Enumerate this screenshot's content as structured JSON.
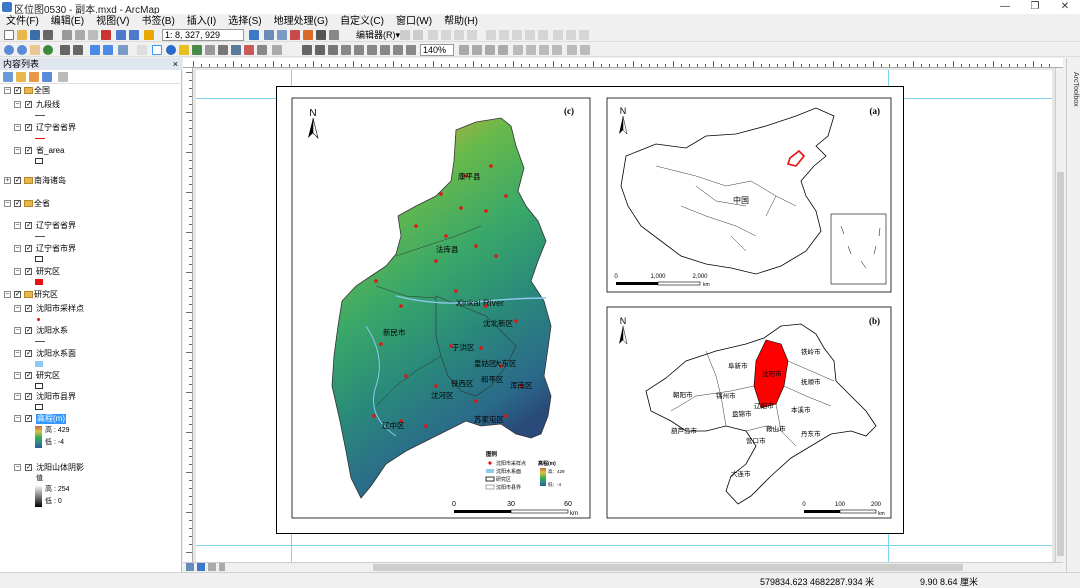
{
  "window": {
    "title": "区位图0530 - 副本.mxd - ArcMap"
  },
  "menu": [
    "文件(F)",
    "编辑(E)",
    "视图(V)",
    "书签(B)",
    "插入(I)",
    "选择(S)",
    "地理处理(G)",
    "自定义(C)",
    "窗口(W)",
    "帮助(H)"
  ],
  "toolbar": {
    "scale": "1: 8, 327, 929",
    "editor_label": "编辑器(R)▾",
    "zoom": "140%"
  },
  "toc": {
    "title": "内容列表",
    "close": "×",
    "items": [
      {
        "type": "group",
        "label": "全国"
      },
      {
        "type": "layer",
        "label": "九段线",
        "sym": "line-gray"
      },
      {
        "type": "layer",
        "label": "辽宁省省界",
        "sym": "line-red"
      },
      {
        "type": "layer",
        "label": "省_area",
        "sym": "box"
      },
      {
        "type": "group",
        "label": "南海诸岛",
        "collapsed": true
      },
      {
        "type": "group",
        "label": "全省"
      },
      {
        "type": "layer",
        "label": "辽宁省省界",
        "sym": "line-gray"
      },
      {
        "type": "layer",
        "label": "辽宁省市界",
        "sym": "box"
      },
      {
        "type": "layer",
        "label": "研究区",
        "sym": "fill-red"
      },
      {
        "type": "group",
        "label": "研究区"
      },
      {
        "type": "layer",
        "label": "沈阳市采样点",
        "sym": "dot-red"
      },
      {
        "type": "layer",
        "label": "沈阳水系",
        "sym": "line-gray"
      },
      {
        "type": "layer",
        "label": "沈阳水系面",
        "sym": "fill-blue"
      },
      {
        "type": "layer",
        "label": "研究区",
        "sym": "box"
      },
      {
        "type": "layer",
        "label": "沈阳市县界",
        "sym": "box"
      },
      {
        "type": "layer",
        "label": "高程(m)",
        "sym": "ramp-dem",
        "selected": true,
        "high": "高 : 429",
        "low": "低 : -4"
      },
      {
        "type": "layer",
        "label": "沈阳山体阴影",
        "sym": "ramp-gray",
        "sublabel": "值",
        "high": "高 : 254",
        "low": "低 : 0"
      }
    ]
  },
  "map": {
    "north": "N",
    "panel_c": {
      "label": "(c)",
      "cities": [
        "康平县",
        "法库县",
        "新民市",
        "沈北新区",
        "于洪区",
        "皇姑区",
        "大东区",
        "铁西区",
        "和平区",
        "浑南区",
        "沈河区",
        "苏家屯区",
        "辽中区"
      ],
      "river": "Xinkai River",
      "scale_ticks": [
        "0",
        "30",
        "60"
      ],
      "scale_unit": "km",
      "legend": {
        "title": "图例",
        "sample": "沈阳市采样点",
        "water": "沈阳水系面",
        "study": "研究区",
        "boundary": "沈阳市县界",
        "dem_title": "高程(m)",
        "dem_high": "高：429",
        "dem_low": "低：-4"
      }
    },
    "panel_a": {
      "label": "(a)",
      "area_label": "中国",
      "scale_ticks": [
        "0",
        "1,000",
        "2,000"
      ],
      "scale_unit": "km"
    },
    "panel_b": {
      "label": "(b)",
      "cities": [
        "铁岭市",
        "阜新市",
        "沈阳市",
        "抚顺市",
        "朝阳市",
        "锦州市",
        "辽阳市",
        "本溪市",
        "盘锦市",
        "葫芦岛市",
        "鞍山市",
        "丹东市",
        "营口市",
        "大连市"
      ],
      "scale_ticks": [
        "0",
        "100",
        "200"
      ],
      "scale_unit": "km"
    }
  },
  "status": {
    "coords": "579834.623  4682287.934 米",
    "page": "9.90  8.64 厘米"
  },
  "side_tab": "ArcToolbox",
  "colors": {
    "accent": "#3a78c8",
    "red": "#e81010",
    "selection": "#3399ff"
  }
}
